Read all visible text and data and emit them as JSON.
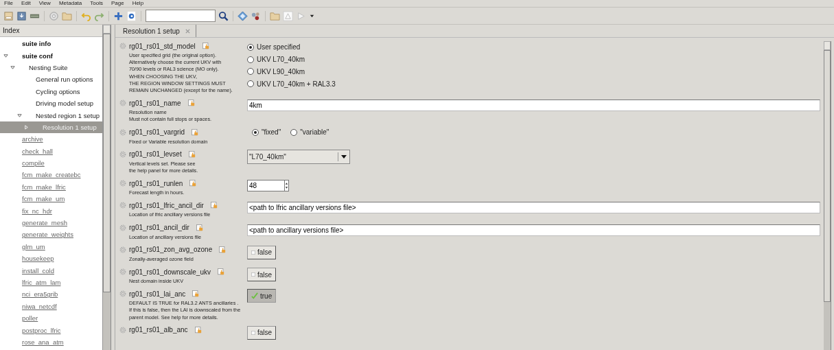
{
  "menu": [
    "File",
    "Edit",
    "View",
    "Metadata",
    "Tools",
    "Page",
    "Help"
  ],
  "sidebar": {
    "title": "Index",
    "items": [
      {
        "label": "suite info",
        "kind": "section",
        "selected": false
      },
      {
        "label": "suite conf",
        "kind": "section",
        "selected": false,
        "expanded": true,
        "children": [
          {
            "label": "Nesting Suite",
            "kind": "page",
            "selected": false,
            "expanded": true,
            "children": [
              {
                "label": "General run options",
                "kind": "page",
                "selected": false
              },
              {
                "label": "Cycling options",
                "kind": "page",
                "selected": false
              },
              {
                "label": "Driving model setup",
                "kind": "page",
                "selected": false
              },
              {
                "label": "Nested region 1 setup",
                "kind": "page",
                "selected": false,
                "expanded": true,
                "children": [
                  {
                    "label": "Resolution 1 setup",
                    "kind": "page",
                    "selected": true,
                    "expanded": false
                  }
                ]
              }
            ]
          }
        ]
      },
      {
        "label": "archive",
        "kind": "task",
        "selected": false
      },
      {
        "label": "check_hall",
        "kind": "task",
        "selected": false
      },
      {
        "label": "compile",
        "kind": "task",
        "selected": false
      },
      {
        "label": "fcm_make_createbc",
        "kind": "task",
        "selected": false
      },
      {
        "label": "fcm_make_lfric",
        "kind": "task",
        "selected": false
      },
      {
        "label": "fcm_make_um",
        "kind": "task",
        "selected": false
      },
      {
        "label": "fix_nc_hdr",
        "kind": "task",
        "selected": false
      },
      {
        "label": "generate_mesh",
        "kind": "task",
        "selected": false
      },
      {
        "label": "generate_weights",
        "kind": "task",
        "selected": false
      },
      {
        "label": "glm_um",
        "kind": "task",
        "selected": false
      },
      {
        "label": "housekeep",
        "kind": "task",
        "selected": false
      },
      {
        "label": "install_cold",
        "kind": "task",
        "selected": false
      },
      {
        "label": "lfric_atm_lam",
        "kind": "task",
        "selected": false
      },
      {
        "label": "nci_era5grib",
        "kind": "task",
        "selected": false
      },
      {
        "label": "niwa_netcdf",
        "kind": "task",
        "selected": false
      },
      {
        "label": "poller",
        "kind": "task",
        "selected": false
      },
      {
        "label": "postproc_lfric",
        "kind": "task",
        "selected": false
      },
      {
        "label": "rose_ana_atm",
        "kind": "task",
        "selected": false
      }
    ]
  },
  "tabs": [
    {
      "label": "Resolution 1 setup",
      "selected": true
    }
  ],
  "settings": [
    {
      "name": "rg01_rs01_std_model",
      "description": "User specified grid (the original option).\nAlternatively choose the current UKV with\n70/90 levels or RAL3 science (MO only).\nWHEN CHOOSING THE UKV,\nTHE REGION WINDOW SETTINGS MUST\nREMAIN UNCHANGED (except for the name).",
      "kind": "radio_list",
      "options": [
        {
          "label": "User specified",
          "selected": true
        },
        {
          "label": "UKV L70_40km",
          "selected": false
        },
        {
          "label": "UKV L90_40km",
          "selected": false
        },
        {
          "label": "UKV L70_40km + RAL3.3",
          "selected": false
        }
      ]
    },
    {
      "name": "rg01_rs01_name",
      "description": "Resolution name\nMust not contain full stops or spaces.",
      "kind": "text",
      "value": "4km"
    },
    {
      "name": "rg01_rs01_vargrid",
      "description": "Fixed or Variable resolution domain",
      "kind": "radio_inline",
      "options": [
        {
          "label": "\"fixed\"",
          "selected": true
        },
        {
          "label": "\"variable\"",
          "selected": false
        }
      ]
    },
    {
      "name": "rg01_rs01_levset",
      "description": "Vertical levels set. Please see\nthe help panel for more details.",
      "kind": "select",
      "value": "\"L70_40km\""
    },
    {
      "name": "rg01_rs01_runlen",
      "description": "Forecast length in hours.",
      "kind": "spin",
      "value": "48"
    },
    {
      "name": "rg01_rs01_lfric_ancil_dir",
      "description": "Location of lfric ancillary versions file",
      "kind": "text",
      "value": "<path to lfric ancillary versions file>"
    },
    {
      "name": "rg01_rs01_ancil_dir",
      "description": "Location of ancillary versions file",
      "kind": "text",
      "value": "<path to ancillary versions file>"
    },
    {
      "name": "rg01_rs01_zon_avg_ozone",
      "description": "Zonally-averaged ozone field",
      "kind": "toggle",
      "checked": false,
      "value": "false"
    },
    {
      "name": "rg01_rs01_downscale_ukv",
      "description": "Nest domain inside UKV",
      "kind": "toggle",
      "checked": false,
      "value": "false"
    },
    {
      "name": "rg01_rs01_lai_anc",
      "description": "DEFAULT IS TRUE for RAL3.2 ANTS ancillaries .\nIf this is false, then the LAI is downscaled from the\nparent model. See help for more details.",
      "kind": "toggle",
      "checked": true,
      "value": "true"
    },
    {
      "name": "rg01_rs01_alb_anc",
      "kind": "toggle",
      "checked": false,
      "value": "false"
    }
  ]
}
